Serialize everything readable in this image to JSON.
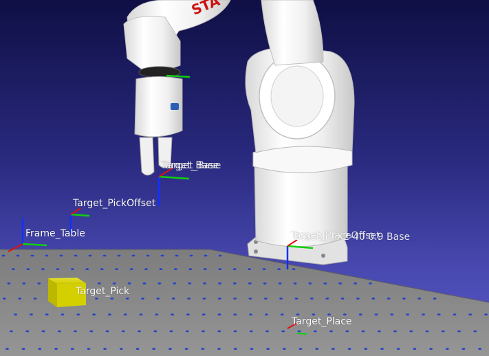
{
  "viewport": {
    "background_top": "#0f0f45",
    "background_bottom": "#5a5ac8",
    "axis_colors": {
      "x": "#e01010",
      "y": "#10d010",
      "z": "#1030ff"
    },
    "table_color": "#8a8a8a",
    "hole_color": "#2244cc",
    "pick_box_color": "#d8d400",
    "robot_color": "#f2f2f2",
    "robot_brand_text": "STA"
  },
  "frames": [
    {
      "key": "target_base_a",
      "label": "Target_Base"
    },
    {
      "key": "target_base_b",
      "label": "Target_Base"
    },
    {
      "key": "target_pickoffset",
      "label": "Target_PickOffset"
    },
    {
      "key": "frame_table",
      "label": "Frame_Table"
    },
    {
      "key": "robot_base_a",
      "label": "Target_PlaceOffset"
    },
    {
      "key": "robot_base_b",
      "label": "Staubli TX2-40 0.9 Base"
    },
    {
      "key": "target_pick",
      "label": "Target_Pick"
    },
    {
      "key": "target_place",
      "label": "Target_Place"
    }
  ]
}
